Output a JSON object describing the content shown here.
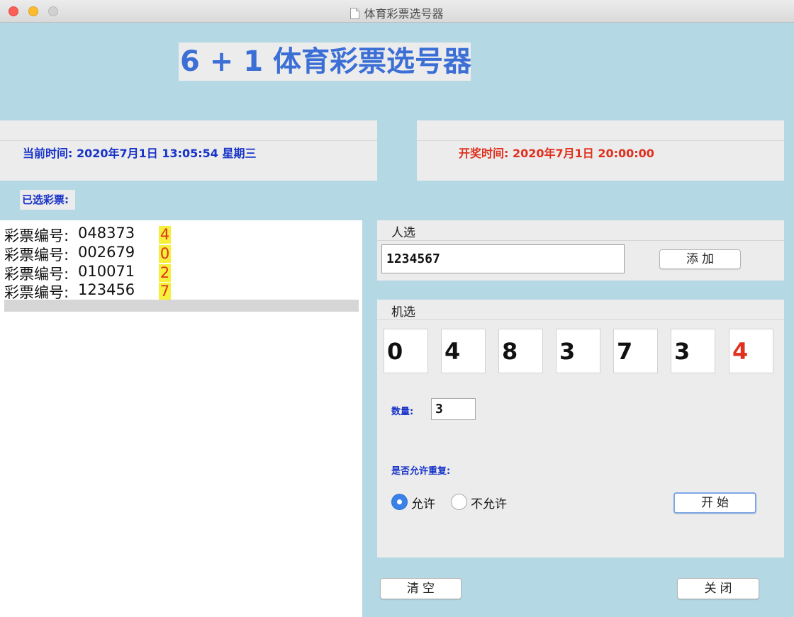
{
  "window": {
    "title": "体育彩票选号器"
  },
  "heading": "6 + 1 体育彩票选号器",
  "current_time": "当前时间:  2020年7月1日  13:05:54  星期三",
  "draw_time": "开奖时间:  2020年7月1日  20:00:00",
  "selected_label": "已选彩票:",
  "tickets": [
    {
      "label": "彩票编号:",
      "number": "048373",
      "last": "4"
    },
    {
      "label": "彩票编号:",
      "number": "002679",
      "last": "0"
    },
    {
      "label": "彩票编号:",
      "number": "010071",
      "last": "2"
    },
    {
      "label": "彩票编号:",
      "number": "123456",
      "last": "7"
    }
  ],
  "manual": {
    "title": "人选",
    "input_value": "1234567",
    "add_label": "添加"
  },
  "machine": {
    "title": "机选",
    "digits": [
      "0",
      "4",
      "8",
      "3",
      "7",
      "3",
      "4"
    ],
    "quantity_label": "数量:",
    "quantity_value": "3",
    "repeat_label": "是否允许重复:",
    "allow_label": "允许",
    "disallow_label": "不允许",
    "allow_selected": true,
    "start_label": "开始"
  },
  "footer": {
    "clear_label": "清空",
    "close_label": "关闭"
  },
  "colors": {
    "background": "#b5d8e5",
    "panel": "#ececec",
    "blue_text": "#1733c8",
    "red_text": "#e0301e",
    "highlight": "#f6f03a",
    "title_blue": "#3c6fd6"
  }
}
